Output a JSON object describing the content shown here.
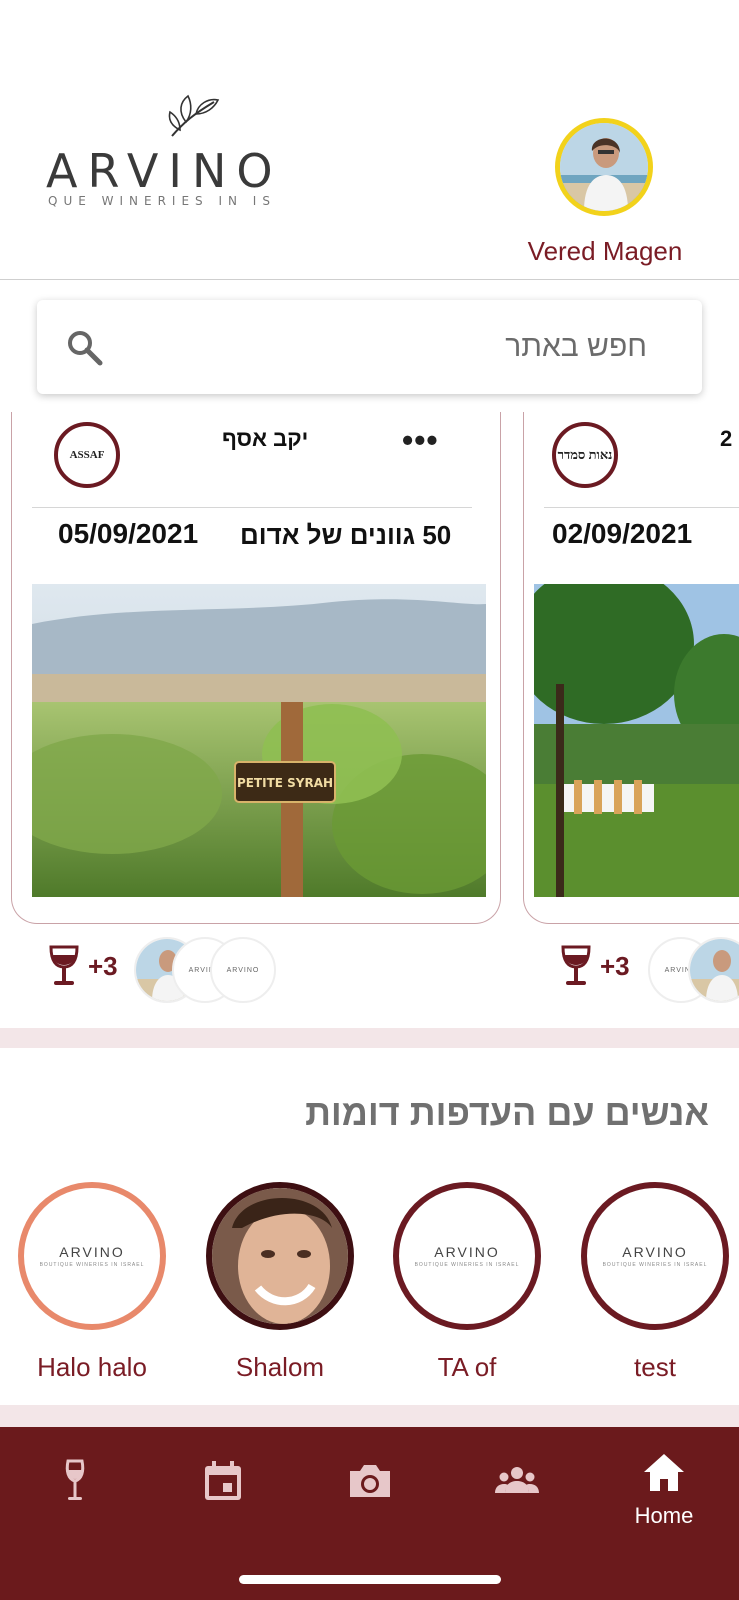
{
  "header": {
    "logo_word": "ARVINO",
    "logo_tagline": "QUE WINERIES IN IS",
    "user_name": "Vered Magen"
  },
  "search": {
    "placeholder": "חפש באתר"
  },
  "cards": [
    {
      "winery": "יקב אסף",
      "logo_text": "ASSAF",
      "subtitle": "50 גוונים של אדום",
      "date": "05/09/2021",
      "reactions": "+3",
      "sign_text": "PETITE SYRAH"
    },
    {
      "winery": "2",
      "logo_text": "נאות סמדר",
      "date": "02/09/2021",
      "reactions": "+3"
    }
  ],
  "similar_people": {
    "title": "אנשים עם העדפות דומות",
    "people": [
      {
        "name": "test",
        "avatar": "arvino-logo"
      },
      {
        "name": "TA of",
        "avatar": "arvino-logo"
      },
      {
        "name": "Shalom",
        "avatar": "photo"
      },
      {
        "name": "Halo halo",
        "avatar": "arvino-logo"
      }
    ],
    "avatar_logo_word": "ARVINO",
    "avatar_logo_tag": "BOUTIQUE WINERIES IN ISRAEL"
  },
  "bottom_nav": {
    "items": [
      {
        "icon": "wine-glass-icon",
        "label": ""
      },
      {
        "icon": "calendar-icon",
        "label": ""
      },
      {
        "icon": "camera-icon",
        "label": ""
      },
      {
        "icon": "people-icon",
        "label": ""
      },
      {
        "icon": "home-icon",
        "label": "Home"
      }
    ]
  },
  "colors": {
    "brand": "#6b1a1c",
    "accent_text": "#7a1c25",
    "avatar_ring": "#f2d21b",
    "highlight_ring": "#e8896b"
  }
}
